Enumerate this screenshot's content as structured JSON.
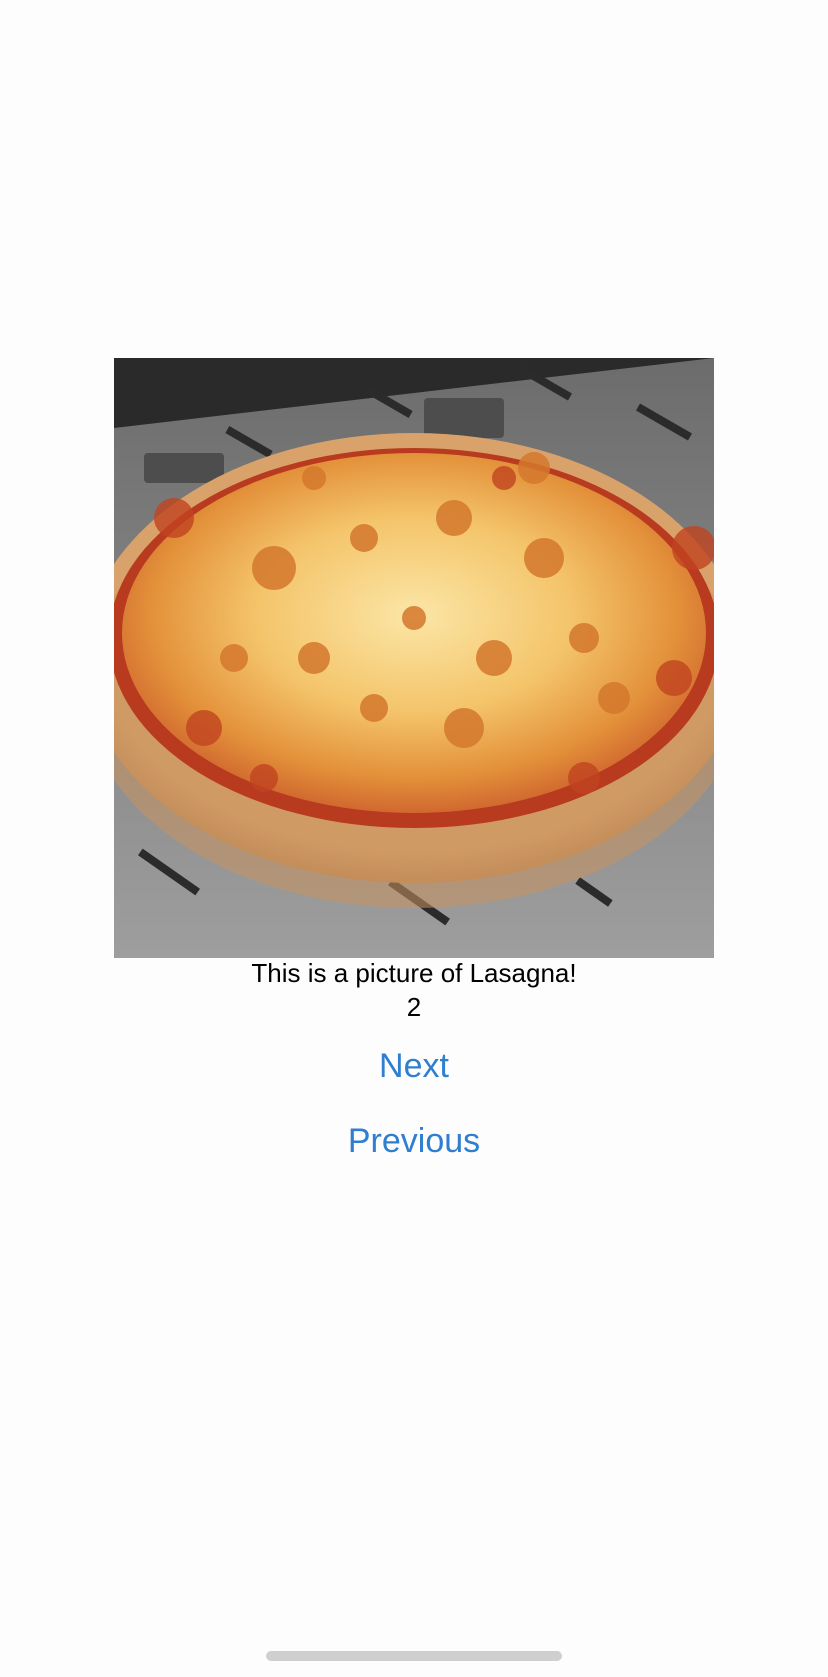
{
  "image": {
    "icon": "pizza-photo",
    "subject": "pizza"
  },
  "caption": {
    "text": "This is a picture of Lasagna!"
  },
  "counter": {
    "value": "2"
  },
  "buttons": {
    "next_label": "Next",
    "previous_label": "Previous"
  },
  "colors": {
    "link_blue": "#2f7ed0",
    "text": "#000000",
    "background": "#fdfdfd",
    "home_indicator": "#cfcfcf"
  }
}
